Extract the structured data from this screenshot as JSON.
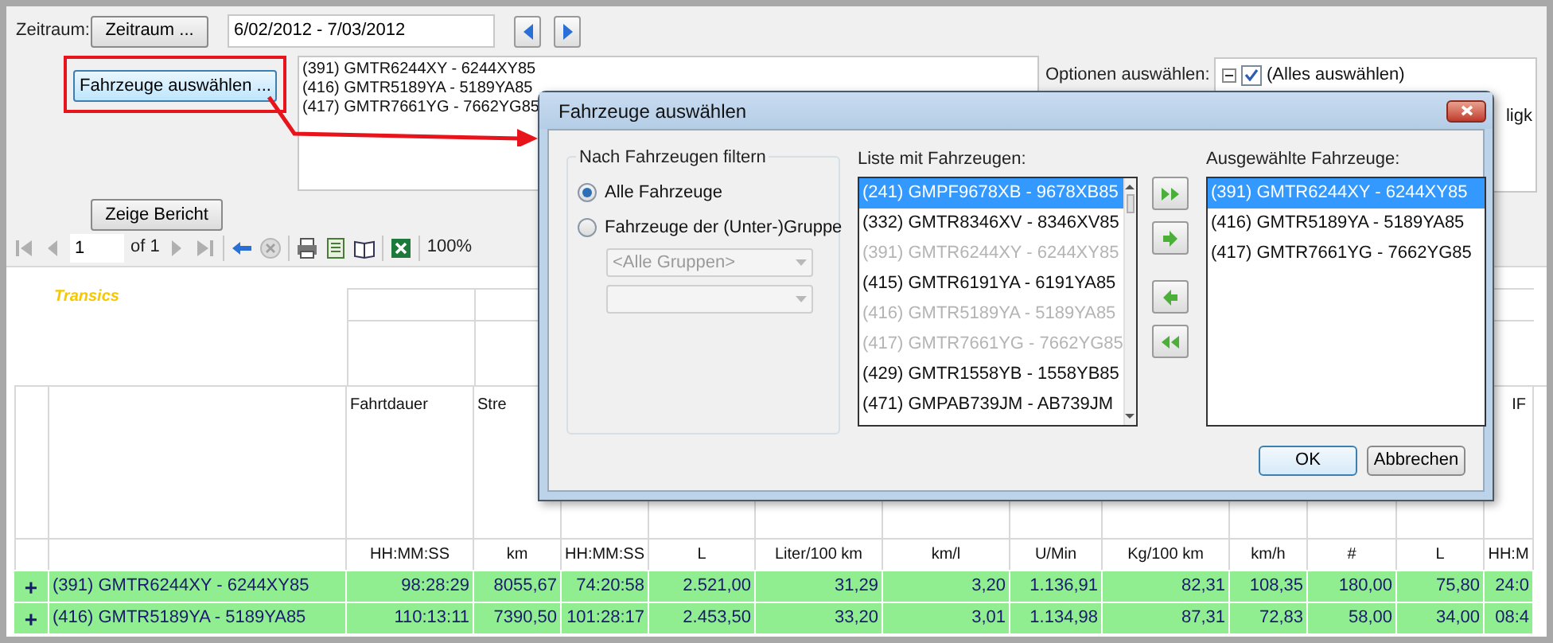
{
  "filter_panel": {
    "period_label": "Zeitraum:",
    "period_button": "Zeitraum ...",
    "period_field": "6/02/2012 - 7/03/2012",
    "vehicles_button": "Fahrzeuge auswählen ...",
    "vehicles_button_highlighted": true,
    "chosen_vehicles": [
      "(391) GMTR6244XY - 6244XY85",
      "(416) GMTR5189YA - 5189YA85",
      "(417) GMTR7661YG - 7662YG85"
    ],
    "options_label": "Optionen auswählen:",
    "options_tree": [
      {
        "label": "(Alles auswählen)",
        "checked": true,
        "expanded": true
      }
    ],
    "partial_text": "ligk",
    "report_button": "Zeige Bericht"
  },
  "pager": {
    "page": "1",
    "page_count": "of 1",
    "zoom": "100%"
  },
  "report": {
    "logo": "Transics",
    "columns": [
      {
        "header": "Fahrtdauer",
        "unit": "HH:MM:SS"
      },
      {
        "header": "Stre",
        "unit": "km"
      },
      {
        "unit": "HH:MM:SS"
      },
      {
        "unit": "L"
      },
      {
        "unit": "Liter/100 km"
      },
      {
        "unit": "km/l"
      },
      {
        "unit": "U/Min"
      },
      {
        "unit": "Kg/100 km"
      },
      {
        "unit": "km/h"
      },
      {
        "unit": "#"
      },
      {
        "unit": "L"
      },
      {
        "header": "IF",
        "unit": "HH:M"
      }
    ],
    "rows": [
      {
        "expand": "+",
        "vehicle": "(391) GMTR6244XY - 6244XY85",
        "values": [
          "98:28:29",
          "8055,67",
          "74:20:58",
          "2.521,00",
          "31,29",
          "3,20",
          "1.136,91",
          "82,31",
          "108,35",
          "180,00",
          "75,80",
          "24:0"
        ]
      },
      {
        "expand": "+",
        "vehicle": "(416) GMTR5189YA - 5189YA85",
        "values": [
          "110:13:11",
          "7390,50",
          "101:28:17",
          "2.453,50",
          "33,20",
          "3,01",
          "1.134,98",
          "87,31",
          "72,83",
          "58,00",
          "34,00",
          "08:4"
        ]
      }
    ]
  },
  "dialog": {
    "title": "Fahrzeuge auswählen",
    "filter_group": {
      "title": "Nach Fahrzeugen filtern",
      "options": [
        {
          "label": "Alle Fahrzeuge",
          "selected": true
        },
        {
          "label": "Fahrzeuge der (Unter-)Gruppe",
          "selected": false
        }
      ],
      "group_dropdown": {
        "value": "<Alle Gruppen>",
        "disabled": true
      },
      "subgroup_dropdown": {
        "disabled": true
      }
    },
    "available_label": "Liste mit Fahrzeugen:",
    "available": [
      {
        "text": "(241) GMPF9678XB - 9678XB85",
        "selected": true,
        "disabled": false
      },
      {
        "text": "(332) GMTR8346XV - 8346XV85",
        "selected": false,
        "disabled": false
      },
      {
        "text": "(391) GMTR6244XY - 6244XY85",
        "selected": false,
        "disabled": true
      },
      {
        "text": "(415) GMTR6191YA - 6191YA85",
        "selected": false,
        "disabled": false
      },
      {
        "text": "(416) GMTR5189YA - 5189YA85",
        "selected": false,
        "disabled": true
      },
      {
        "text": "(417) GMTR7661YG - 7662YG85",
        "selected": false,
        "disabled": true
      },
      {
        "text": "(429) GMTR1558YB - 1558YB85",
        "selected": false,
        "disabled": false
      },
      {
        "text": "(471) GMPAB739JM - AB739JM",
        "selected": false,
        "disabled": false
      }
    ],
    "chosen_label": "Ausgewählte Fahrzeuge:",
    "chosen": [
      {
        "text": "(391) GMTR6244XY - 6244XY85",
        "selected": true
      },
      {
        "text": "(416) GMTR5189YA - 5189YA85",
        "selected": false
      },
      {
        "text": "(417) GMTR7661YG - 7662YG85",
        "selected": false
      }
    ],
    "ok_button": "OK",
    "cancel_button": "Abbrechen"
  }
}
